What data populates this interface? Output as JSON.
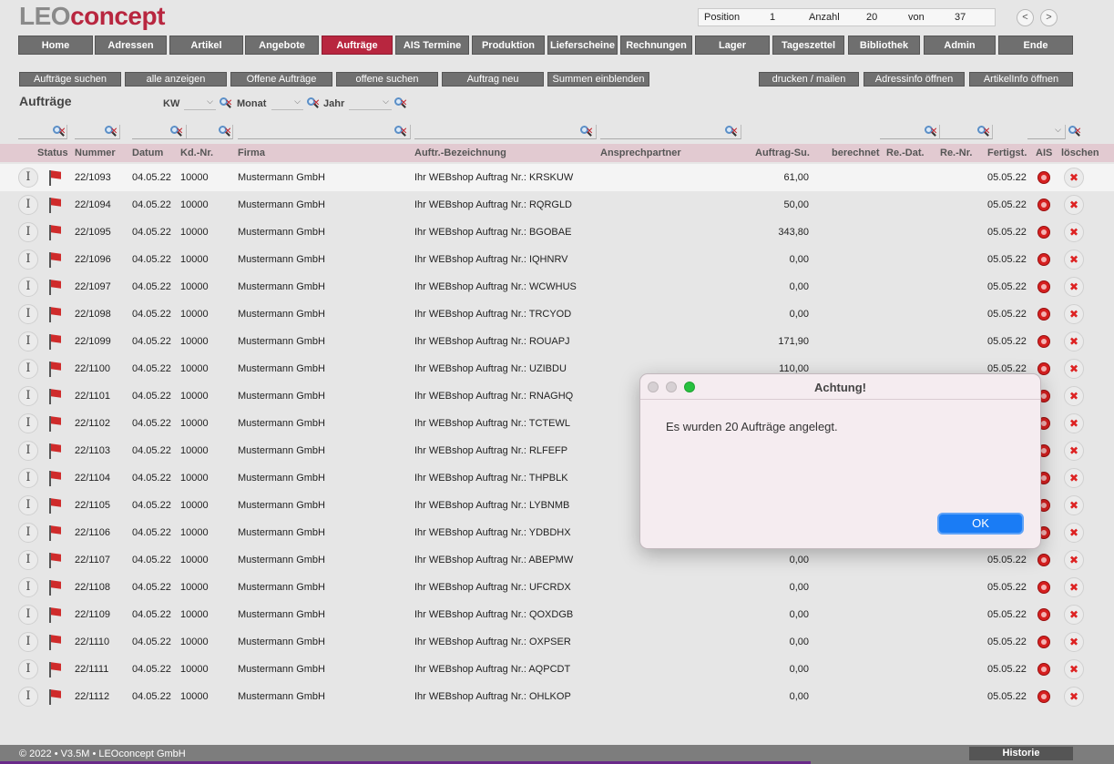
{
  "logo": {
    "part1": "LEO",
    "part2": "concept"
  },
  "position_box": {
    "position_label": "Position",
    "position_value": "1",
    "count_label": "Anzahl",
    "count_value": "20",
    "of_label": "von",
    "of_value": "37"
  },
  "pager": {
    "prev": "<",
    "next": ">"
  },
  "main_nav": [
    {
      "label": "Home"
    },
    {
      "label": "Adressen"
    },
    {
      "label": "Artikel"
    },
    {
      "label": "Angebote"
    },
    {
      "label": "Aufträge"
    },
    {
      "label": "AIS Termine"
    },
    {
      "label": "Produktion"
    },
    {
      "label": "Lieferscheine"
    },
    {
      "label": "Rechnungen"
    },
    {
      "label": "Lager"
    },
    {
      "label": "Tageszettel"
    },
    {
      "label": "Bibliothek"
    },
    {
      "label": "Admin"
    },
    {
      "label": "Ende"
    }
  ],
  "active_nav": "Aufträge",
  "actions": {
    "search": "Aufträge suchen",
    "show_all": "alle anzeigen",
    "open_orders": "Offene Aufträge",
    "search_open": "offene suchen",
    "new_order": "Auftrag neu",
    "show_sums": "Summen einblenden",
    "print_mail": "drucken / mailen",
    "address_info": "Adressinfo öffnen",
    "article_info": "ArtikelInfo öffnen"
  },
  "page_title": "Aufträge",
  "filters": {
    "kw": "KW",
    "month": "Monat",
    "year": "Jahr"
  },
  "columns": {
    "status": "Status",
    "number": "Nummer",
    "date": "Datum",
    "customer_no": "Kd.-Nr.",
    "company": "Firma",
    "description": "Auftr.-Bezeichnung",
    "contact": "Ansprechpartner",
    "order_sum": "Auftrag-Su.",
    "billed": "berechnet",
    "invoice_date": "Re.-Dat.",
    "invoice_no": "Re.-Nr.",
    "finished": "Fertigst.",
    "ais": "AIS",
    "delete": "löschen"
  },
  "rows": [
    {
      "status": "I",
      "number": "22/1093",
      "date": "04.05.22",
      "customer_no": "10000",
      "company": "Mustermann GmbH",
      "description": "Ihr WEBshop Auftrag Nr.: KRSKUW",
      "order_sum": "61,00",
      "finished": "05.05.22"
    },
    {
      "status": "I",
      "number": "22/1094",
      "date": "04.05.22",
      "customer_no": "10000",
      "company": "Mustermann GmbH",
      "description": "Ihr WEBshop Auftrag Nr.: RQRGLD",
      "order_sum": "50,00",
      "finished": "05.05.22"
    },
    {
      "status": "I",
      "number": "22/1095",
      "date": "04.05.22",
      "customer_no": "10000",
      "company": "Mustermann GmbH",
      "description": "Ihr WEBshop Auftrag Nr.: BGOBAE",
      "order_sum": "343,80",
      "finished": "05.05.22"
    },
    {
      "status": "I",
      "number": "22/1096",
      "date": "04.05.22",
      "customer_no": "10000",
      "company": "Mustermann GmbH",
      "description": "Ihr WEBshop Auftrag Nr.: IQHNRV",
      "order_sum": "0,00",
      "finished": "05.05.22"
    },
    {
      "status": "I",
      "number": "22/1097",
      "date": "04.05.22",
      "customer_no": "10000",
      "company": "Mustermann GmbH",
      "description": "Ihr WEBshop Auftrag Nr.: WCWHUS",
      "order_sum": "0,00",
      "finished": "05.05.22"
    },
    {
      "status": "I",
      "number": "22/1098",
      "date": "04.05.22",
      "customer_no": "10000",
      "company": "Mustermann GmbH",
      "description": "Ihr WEBshop Auftrag Nr.: TRCYOD",
      "order_sum": "0,00",
      "finished": "05.05.22"
    },
    {
      "status": "I",
      "number": "22/1099",
      "date": "04.05.22",
      "customer_no": "10000",
      "company": "Mustermann GmbH",
      "description": "Ihr WEBshop Auftrag Nr.: ROUAPJ",
      "order_sum": "171,90",
      "finished": "05.05.22"
    },
    {
      "status": "I",
      "number": "22/1100",
      "date": "04.05.22",
      "customer_no": "10000",
      "company": "Mustermann GmbH",
      "description": "Ihr WEBshop Auftrag Nr.: UZIBDU",
      "order_sum": "110,00",
      "finished": "05.05.22"
    },
    {
      "status": "I",
      "number": "22/1101",
      "date": "04.05.22",
      "customer_no": "10000",
      "company": "Mustermann GmbH",
      "description": "Ihr WEBshop Auftrag Nr.: RNAGHQ",
      "order_sum": "",
      "finished": ""
    },
    {
      "status": "I",
      "number": "22/1102",
      "date": "04.05.22",
      "customer_no": "10000",
      "company": "Mustermann GmbH",
      "description": "Ihr WEBshop Auftrag Nr.: TCTEWL",
      "order_sum": "",
      "finished": ""
    },
    {
      "status": "I",
      "number": "22/1103",
      "date": "04.05.22",
      "customer_no": "10000",
      "company": "Mustermann GmbH",
      "description": "Ihr WEBshop Auftrag Nr.: RLFEFP",
      "order_sum": "",
      "finished": ""
    },
    {
      "status": "I",
      "number": "22/1104",
      "date": "04.05.22",
      "customer_no": "10000",
      "company": "Mustermann GmbH",
      "description": "Ihr WEBshop Auftrag Nr.: THPBLK",
      "order_sum": "",
      "finished": ""
    },
    {
      "status": "I",
      "number": "22/1105",
      "date": "04.05.22",
      "customer_no": "10000",
      "company": "Mustermann GmbH",
      "description": "Ihr WEBshop Auftrag Nr.: LYBNMB",
      "order_sum": "",
      "finished": ""
    },
    {
      "status": "I",
      "number": "22/1106",
      "date": "04.05.22",
      "customer_no": "10000",
      "company": "Mustermann GmbH",
      "description": "Ihr WEBshop Auftrag Nr.: YDBDHX",
      "order_sum": "",
      "finished": ""
    },
    {
      "status": "I",
      "number": "22/1107",
      "date": "04.05.22",
      "customer_no": "10000",
      "company": "Mustermann GmbH",
      "description": "Ihr WEBshop Auftrag Nr.: ABEPMW",
      "order_sum": "0,00",
      "finished": "05.05.22"
    },
    {
      "status": "I",
      "number": "22/1108",
      "date": "04.05.22",
      "customer_no": "10000",
      "company": "Mustermann GmbH",
      "description": "Ihr WEBshop Auftrag Nr.: UFCRDX",
      "order_sum": "0,00",
      "finished": "05.05.22"
    },
    {
      "status": "I",
      "number": "22/1109",
      "date": "04.05.22",
      "customer_no": "10000",
      "company": "Mustermann GmbH",
      "description": "Ihr WEBshop Auftrag Nr.: QOXDGB",
      "order_sum": "0,00",
      "finished": "05.05.22"
    },
    {
      "status": "I",
      "number": "22/1110",
      "date": "04.05.22",
      "customer_no": "10000",
      "company": "Mustermann GmbH",
      "description": "Ihr WEBshop Auftrag Nr.: OXPSER",
      "order_sum": "0,00",
      "finished": "05.05.22"
    },
    {
      "status": "I",
      "number": "22/1111",
      "date": "04.05.22",
      "customer_no": "10000",
      "company": "Mustermann GmbH",
      "description": "Ihr WEBshop Auftrag Nr.: AQPCDT",
      "order_sum": "0,00",
      "finished": "05.05.22"
    },
    {
      "status": "I",
      "number": "22/1112",
      "date": "04.05.22",
      "customer_no": "10000",
      "company": "Mustermann GmbH",
      "description": "Ihr WEBshop Auftrag Nr.: OHLKOP",
      "order_sum": "0,00",
      "finished": "05.05.22"
    }
  ],
  "row_icons": {
    "status_flag": "red-flag-icon",
    "ais": "red-target-icon",
    "delete": "close-icon",
    "delete_glyph": "✖"
  },
  "footer": {
    "copyright": "© 2022 • V3.5M • LEOconcept GmbH",
    "history": "Historie"
  },
  "dialog": {
    "title": "Achtung!",
    "message": "Es wurden 20 Aufträge angelegt.",
    "ok": "OK"
  },
  "colors": {
    "brand": "#b8263f",
    "nav": "#6f6f6f",
    "header_row": "#e2cad1",
    "ok_button": "#1a7cf5"
  }
}
